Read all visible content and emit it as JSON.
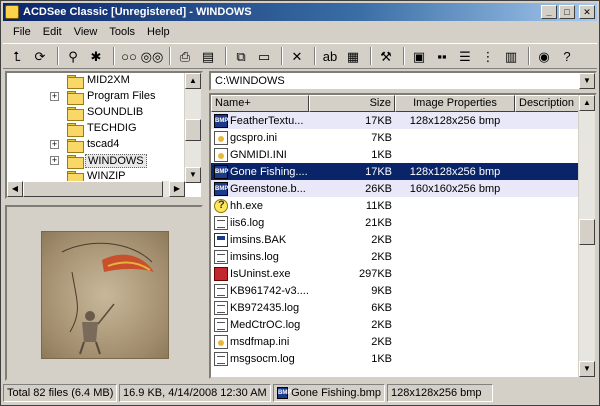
{
  "window": {
    "title": "ACDSee Classic [Unregistered] - WINDOWS"
  },
  "menu": [
    "File",
    "Edit",
    "View",
    "Tools",
    "Help"
  ],
  "toolbar": [
    {
      "icon": "folder-up-icon",
      "glyph": "⮤"
    },
    {
      "icon": "refresh-icon",
      "glyph": "⟳"
    },
    {
      "icon": "find-icon",
      "glyph": "⚲"
    },
    {
      "icon": "favorites-icon",
      "glyph": "✱"
    },
    {
      "icon": "view-single-icon",
      "glyph": "○○"
    },
    {
      "icon": "view-multi-icon",
      "glyph": "◎◎"
    },
    {
      "icon": "print-icon",
      "glyph": "⎙"
    },
    {
      "icon": "scan-icon",
      "glyph": "▤"
    },
    {
      "icon": "copy-icon",
      "glyph": "⧉"
    },
    {
      "icon": "move-icon",
      "glyph": "▭"
    },
    {
      "icon": "delete-icon",
      "glyph": "✕"
    },
    {
      "icon": "rename-icon",
      "glyph": "ab"
    },
    {
      "icon": "properties-icon",
      "glyph": "▦"
    },
    {
      "icon": "tools-icon",
      "glyph": "⚒"
    },
    {
      "icon": "large-icons-icon",
      "glyph": "▣"
    },
    {
      "icon": "small-icons-icon",
      "glyph": "▪▪"
    },
    {
      "icon": "list-icon",
      "glyph": "☰"
    },
    {
      "icon": "tree-icon",
      "glyph": "⋮"
    },
    {
      "icon": "details-icon",
      "glyph": "▥"
    },
    {
      "icon": "preview-icon",
      "glyph": "◉"
    },
    {
      "icon": "help-icon",
      "glyph": "?"
    }
  ],
  "tree": {
    "items": [
      {
        "label": "MID2XM",
        "expandable": false
      },
      {
        "label": "Program Files",
        "expandable": true
      },
      {
        "label": "SOUNDLIB",
        "expandable": false
      },
      {
        "label": "TECHDIG",
        "expandable": false
      },
      {
        "label": "tscad4",
        "expandable": true
      },
      {
        "label": "WINDOWS",
        "expandable": true,
        "selected": true
      },
      {
        "label": "WINZIP",
        "expandable": false
      }
    ]
  },
  "path": {
    "value": "C:\\WINDOWS"
  },
  "list": {
    "columns": [
      "Name+",
      "Size",
      "Image Properties",
      "Description"
    ],
    "rows": [
      {
        "name": "FeatherTextu...",
        "size": "17KB",
        "props": "128x128x256 bmp",
        "type": "bmp",
        "state": "tinted"
      },
      {
        "name": "gcspro.ini",
        "size": "7KB",
        "props": "",
        "type": "ini",
        "state": ""
      },
      {
        "name": "GNMIDI.INI",
        "size": "1KB",
        "props": "",
        "type": "ini",
        "state": ""
      },
      {
        "name": "Gone Fishing....",
        "size": "17KB",
        "props": "128x128x256 bmp",
        "type": "bmp",
        "state": "selected"
      },
      {
        "name": "Greenstone.b...",
        "size": "26KB",
        "props": "160x160x256 bmp",
        "type": "bmp",
        "state": "tinted"
      },
      {
        "name": "hh.exe",
        "size": "11KB",
        "props": "",
        "type": "exe",
        "state": ""
      },
      {
        "name": "iis6.log",
        "size": "21KB",
        "props": "",
        "type": "doc",
        "state": ""
      },
      {
        "name": "imsins.BAK",
        "size": "2KB",
        "props": "",
        "type": "bak",
        "state": ""
      },
      {
        "name": "imsins.log",
        "size": "2KB",
        "props": "",
        "type": "doc",
        "state": ""
      },
      {
        "name": "IsUninst.exe",
        "size": "297KB",
        "props": "",
        "type": "uninst",
        "state": ""
      },
      {
        "name": "KB961742-v3....",
        "size": "9KB",
        "props": "",
        "type": "doc",
        "state": ""
      },
      {
        "name": "KB972435.log",
        "size": "6KB",
        "props": "",
        "type": "doc",
        "state": ""
      },
      {
        "name": "MedCtrOC.log",
        "size": "2KB",
        "props": "",
        "type": "doc",
        "state": ""
      },
      {
        "name": "msdfmap.ini",
        "size": "2KB",
        "props": "",
        "type": "ini",
        "state": ""
      },
      {
        "name": "msgsocm.log",
        "size": "1KB",
        "props": "",
        "type": "doc",
        "state": ""
      }
    ]
  },
  "status": {
    "total": "Total 82 files (6.4 MB)",
    "info": "16.9 KB, 4/14/2008 12:30 AM",
    "file": "Gone Fishing.bmp",
    "props": "128x128x256 bmp"
  }
}
